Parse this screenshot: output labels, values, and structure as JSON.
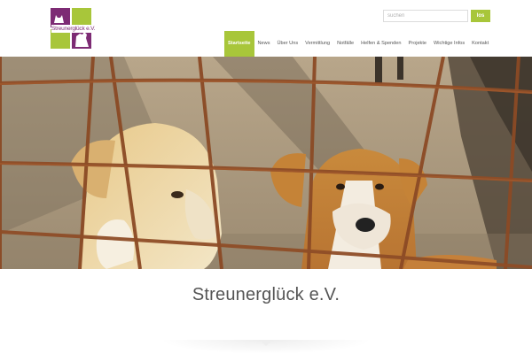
{
  "header": {
    "logo": {
      "text": "Streunerglück e.V."
    },
    "search": {
      "placeholder": "suchen",
      "button_label": "los"
    }
  },
  "nav": {
    "items": [
      {
        "label": "Startseite",
        "active": true
      },
      {
        "label": "News",
        "active": false
      },
      {
        "label": "Über Uns",
        "active": false
      },
      {
        "label": "Vermittlung",
        "active": false
      },
      {
        "label": "Notfälle",
        "active": false
      },
      {
        "label": "Helfen & Spenden",
        "active": false
      },
      {
        "label": "Projekte",
        "active": false
      },
      {
        "label": "Wichtige Infos",
        "active": false
      },
      {
        "label": "Kontakt",
        "active": false
      }
    ]
  },
  "hero": {
    "image": "dogs-behind-fence-photo"
  },
  "main": {
    "title": "Streunerglück e.V."
  },
  "colors": {
    "brand_green": "#a8c63a",
    "brand_purple": "#7d2b74",
    "text_gray": "#555555"
  }
}
